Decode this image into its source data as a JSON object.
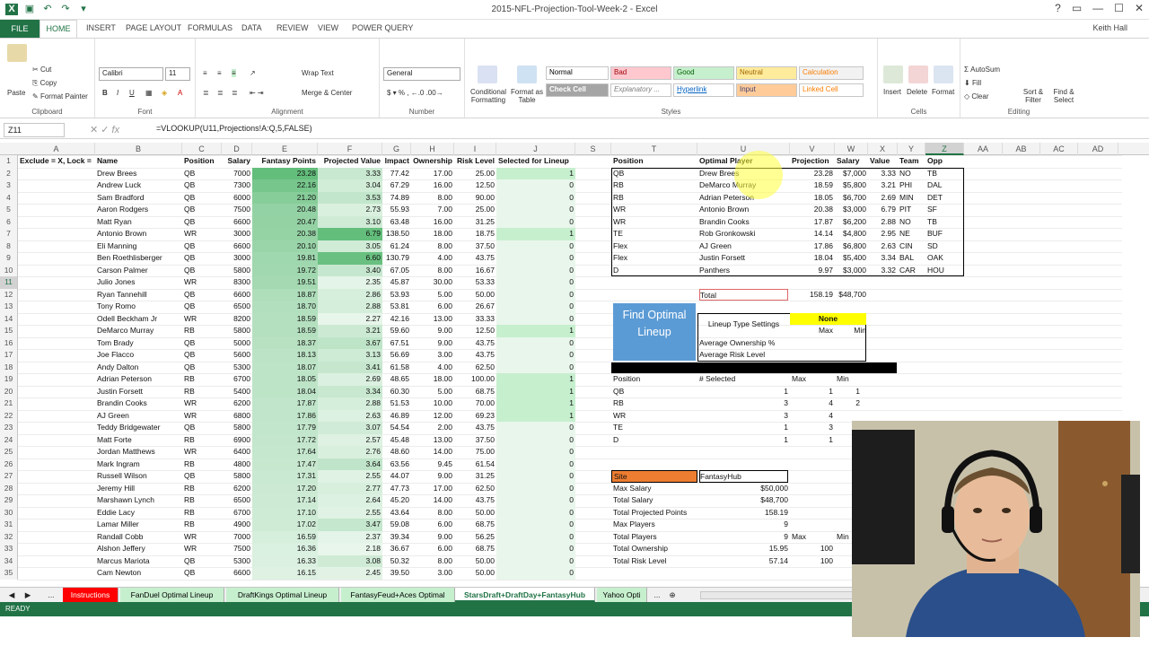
{
  "window": {
    "title": "2015-NFL-Projection-Tool-Week-2 - Excel",
    "user": "Keith Hall",
    "help": "?"
  },
  "menu": [
    "FILE",
    "HOME",
    "INSERT",
    "PAGE LAYOUT",
    "FORMULAS",
    "DATA",
    "REVIEW",
    "VIEW",
    "POWER QUERY"
  ],
  "ribbon": {
    "clipboard": {
      "label": "Clipboard",
      "paste": "Paste",
      "cut": "Cut",
      "copy": "Copy",
      "painter": "Format Painter"
    },
    "font": {
      "label": "Font",
      "name": "Calibri",
      "size": "11"
    },
    "alignment": {
      "label": "Alignment",
      "wrap": "Wrap Text",
      "merge": "Merge & Center"
    },
    "number": {
      "label": "Number",
      "format": "General"
    },
    "styles": {
      "label": "Styles",
      "cond": "Conditional Formatting",
      "table": "Format as Table",
      "items": [
        {
          "t": "Normal",
          "bg": "#ffffff",
          "fg": "#000000"
        },
        {
          "t": "Bad",
          "bg": "#ffc7ce",
          "fg": "#9c0006"
        },
        {
          "t": "Good",
          "bg": "#c6efce",
          "fg": "#006100"
        },
        {
          "t": "Neutral",
          "bg": "#ffeb9c",
          "fg": "#9c6500"
        },
        {
          "t": "Calculation",
          "bg": "#f2f2f2",
          "fg": "#fa7d00"
        },
        {
          "t": "Check Cell",
          "bg": "#a5a5a5",
          "fg": "#ffffff"
        },
        {
          "t": "Explanatory ...",
          "bg": "#ffffff",
          "fg": "#7f7f7f"
        },
        {
          "t": "Hyperlink",
          "bg": "#ffffff",
          "fg": "#0563c1"
        },
        {
          "t": "Input",
          "bg": "#ffcc99",
          "fg": "#3f3f76"
        },
        {
          "t": "Linked Cell",
          "bg": "#ffffff",
          "fg": "#fa7d00"
        }
      ]
    },
    "cells": {
      "label": "Cells",
      "insert": "Insert",
      "delete": "Delete",
      "format": "Format"
    },
    "editing": {
      "label": "Editing",
      "autosum": "AutoSum",
      "fill": "Fill",
      "clear": "Clear",
      "sort": "Sort & Filter",
      "find": "Find & Select"
    }
  },
  "formula_bar": {
    "cell": "Z11",
    "formula": "=VLOOKUP(U11,Projections!A:Q,5,FALSE)",
    "fx": "fx"
  },
  "columns": [
    "A",
    "B",
    "C",
    "D",
    "E",
    "F",
    "G",
    "H",
    "I",
    "J",
    "S",
    "T",
    "U",
    "V",
    "W",
    "X",
    "Y",
    "Z",
    "AA",
    "AB",
    "AC",
    "AD"
  ],
  "left_headers": [
    "Exclude = X, Lock = L",
    "Name",
    "Position",
    "Salary",
    "Fantasy Points",
    "Projected Value",
    "Impact",
    "Ownership",
    "Risk Level",
    "Selected for Lineup"
  ],
  "players": [
    [
      "Drew Brees",
      "QB",
      "7000",
      "23.28",
      "3.33",
      "77.42",
      "17.00",
      "25.00",
      "1"
    ],
    [
      "Andrew Luck",
      "QB",
      "7300",
      "22.16",
      "3.04",
      "67.29",
      "16.00",
      "12.50",
      "0"
    ],
    [
      "Sam Bradford",
      "QB",
      "6000",
      "21.20",
      "3.53",
      "74.89",
      "8.00",
      "90.00",
      "0"
    ],
    [
      "Aaron Rodgers",
      "QB",
      "7500",
      "20.48",
      "2.73",
      "55.93",
      "7.00",
      "25.00",
      "0"
    ],
    [
      "Matt Ryan",
      "QB",
      "6600",
      "20.47",
      "3.10",
      "63.48",
      "16.00",
      "31.25",
      "0"
    ],
    [
      "Antonio Brown",
      "WR",
      "3000",
      "20.38",
      "6.79",
      "138.50",
      "18.00",
      "18.75",
      "1"
    ],
    [
      "Eli Manning",
      "QB",
      "6600",
      "20.10",
      "3.05",
      "61.24",
      "8.00",
      "37.50",
      "0"
    ],
    [
      "Ben Roethlisberger",
      "QB",
      "3000",
      "19.81",
      "6.60",
      "130.79",
      "4.00",
      "43.75",
      "0"
    ],
    [
      "Carson Palmer",
      "QB",
      "5800",
      "19.72",
      "3.40",
      "67.05",
      "8.00",
      "16.67",
      "0"
    ],
    [
      "Julio Jones",
      "WR",
      "8300",
      "19.51",
      "2.35",
      "45.87",
      "30.00",
      "53.33",
      "0"
    ],
    [
      "Ryan Tannehill",
      "QB",
      "6600",
      "18.87",
      "2.86",
      "53.93",
      "5.00",
      "50.00",
      "0"
    ],
    [
      "Tony Romo",
      "QB",
      "6500",
      "18.70",
      "2.88",
      "53.81",
      "6.00",
      "26.67",
      "0"
    ],
    [
      "Odell Beckham Jr",
      "WR",
      "8200",
      "18.59",
      "2.27",
      "42.16",
      "13.00",
      "33.33",
      "0"
    ],
    [
      "DeMarco Murray",
      "RB",
      "5800",
      "18.59",
      "3.21",
      "59.60",
      "9.00",
      "12.50",
      "1"
    ],
    [
      "Tom Brady",
      "QB",
      "5000",
      "18.37",
      "3.67",
      "67.51",
      "9.00",
      "43.75",
      "0"
    ],
    [
      "Joe Flacco",
      "QB",
      "5600",
      "18.13",
      "3.13",
      "56.69",
      "3.00",
      "43.75",
      "0"
    ],
    [
      "Andy Dalton",
      "QB",
      "5300",
      "18.07",
      "3.41",
      "61.58",
      "4.00",
      "62.50",
      "0"
    ],
    [
      "Adrian Peterson",
      "RB",
      "6700",
      "18.05",
      "2.69",
      "48.65",
      "18.00",
      "100.00",
      "1"
    ],
    [
      "Justin Forsett",
      "RB",
      "5400",
      "18.04",
      "3.34",
      "60.30",
      "5.00",
      "68.75",
      "1"
    ],
    [
      "Brandin Cooks",
      "WR",
      "6200",
      "17.87",
      "2.88",
      "51.53",
      "10.00",
      "70.00",
      "1"
    ],
    [
      "AJ Green",
      "WR",
      "6800",
      "17.86",
      "2.63",
      "46.89",
      "12.00",
      "69.23",
      "1"
    ],
    [
      "Teddy Bridgewater",
      "QB",
      "5800",
      "17.79",
      "3.07",
      "54.54",
      "2.00",
      "43.75",
      "0"
    ],
    [
      "Matt Forte",
      "RB",
      "6900",
      "17.72",
      "2.57",
      "45.48",
      "13.00",
      "37.50",
      "0"
    ],
    [
      "Jordan Matthews",
      "WR",
      "6400",
      "17.64",
      "2.76",
      "48.60",
      "14.00",
      "75.00",
      "0"
    ],
    [
      "Mark Ingram",
      "RB",
      "4800",
      "17.47",
      "3.64",
      "63.56",
      "9.45",
      "61.54",
      "0"
    ],
    [
      "Russell Wilson",
      "QB",
      "5800",
      "17.31",
      "2.55",
      "44.07",
      "9.00",
      "31.25",
      "0"
    ],
    [
      "Jeremy Hill",
      "RB",
      "6200",
      "17.20",
      "2.77",
      "47.73",
      "17.00",
      "62.50",
      "0"
    ],
    [
      "Marshawn Lynch",
      "RB",
      "6500",
      "17.14",
      "2.64",
      "45.20",
      "14.00",
      "43.75",
      "0"
    ],
    [
      "Eddie Lacy",
      "RB",
      "6700",
      "17.10",
      "2.55",
      "43.64",
      "8.00",
      "50.00",
      "0"
    ],
    [
      "Lamar Miller",
      "RB",
      "4900",
      "17.02",
      "3.47",
      "59.08",
      "6.00",
      "68.75",
      "0"
    ],
    [
      "Randall Cobb",
      "WR",
      "7000",
      "16.59",
      "2.37",
      "39.34",
      "9.00",
      "56.25",
      "0"
    ],
    [
      "Alshon Jeffery",
      "WR",
      "7500",
      "16.36",
      "2.18",
      "36.67",
      "6.00",
      "68.75",
      "0"
    ],
    [
      "Marcus Mariota",
      "QB",
      "5300",
      "16.33",
      "3.08",
      "50.32",
      "8.00",
      "50.00",
      "0"
    ],
    [
      "Cam Newton",
      "QB",
      "6600",
      "16.15",
      "2.45",
      "39.50",
      "3.00",
      "50.00",
      "0"
    ]
  ],
  "lineup_headers": [
    "Position",
    "Optimal Player",
    "Projection",
    "Salary",
    "Value",
    "Team",
    "Opp"
  ],
  "lineup": [
    [
      "QB",
      "Drew Brees",
      "23.28",
      "$7,000",
      "3.33",
      "NO",
      "TB"
    ],
    [
      "RB",
      "DeMarco Murray",
      "18.59",
      "$5,800",
      "3.21",
      "PHI",
      "DAL"
    ],
    [
      "RB",
      "Adrian Peterson",
      "18.05",
      "$6,700",
      "2.69",
      "MIN",
      "DET"
    ],
    [
      "WR",
      "Antonio Brown",
      "20.38",
      "$3,000",
      "6.79",
      "PIT",
      "SF"
    ],
    [
      "WR",
      "Brandin Cooks",
      "17.87",
      "$6,200",
      "2.88",
      "NO",
      "TB"
    ],
    [
      "TE",
      "Rob Gronkowski",
      "14.14",
      "$4,800",
      "2.95",
      "NE",
      "BUF"
    ],
    [
      "Flex",
      "AJ Green",
      "17.86",
      "$6,800",
      "2.63",
      "CIN",
      "SD"
    ],
    [
      "Flex",
      "Justin Forsett",
      "18.04",
      "$5,400",
      "3.34",
      "BAL",
      "OAK"
    ],
    [
      "D",
      "Panthers",
      "9.97",
      "$3,000",
      "3.32",
      "CAR",
      "HOU"
    ]
  ],
  "total": {
    "label": "Total",
    "projection": "158.19",
    "salary": "$48,700"
  },
  "find_button": "Find Optimal Lineup",
  "settings": {
    "title": "Lineup Type Settings",
    "value": "None",
    "max": "Max",
    "min": "Min",
    "own": "Average Ownership %",
    "risk": "Average Risk Level"
  },
  "constraints": {
    "headers": [
      "Position",
      "# Selected",
      "Max",
      "Min"
    ],
    "rows": [
      [
        "QB",
        "1",
        "1",
        "1"
      ],
      [
        "RB",
        "3",
        "4",
        "2"
      ],
      [
        "WR",
        "3",
        "4",
        ""
      ],
      [
        "TE",
        "1",
        "3",
        ""
      ],
      [
        "D",
        "1",
        "1",
        ""
      ]
    ]
  },
  "site": {
    "label": "Site",
    "value": "FantasyHub"
  },
  "summary": [
    [
      "Max Salary",
      "$50,000",
      "",
      ""
    ],
    [
      "Total Salary",
      "$48,700",
      "",
      ""
    ],
    [
      "Total Projected Points",
      "158.19",
      "",
      ""
    ],
    [
      "Max Players",
      "9",
      "",
      ""
    ],
    [
      "Total Players",
      "9",
      "Max",
      "Min"
    ],
    [
      "Total Ownership",
      "15.95",
      "100",
      ""
    ],
    [
      "Total Risk Level",
      "57.14",
      "100",
      ""
    ]
  ],
  "sheet_tabs": [
    {
      "t": "Instructions",
      "bg": "#ff0000",
      "fg": "#ffffff"
    },
    {
      "t": "FanDuel Optimal Lineup",
      "bg": "#c6efce",
      "fg": "#000000"
    },
    {
      "t": "DraftKings Optimal Lineup",
      "bg": "#c6efce",
      "fg": "#000000"
    },
    {
      "t": "FantasyFeud+Aces Optimal",
      "bg": "#c6efce",
      "fg": "#000000"
    },
    {
      "t": "StarsDraft+DraftDay+FantasyHub",
      "bg": "#ffffff",
      "fg": "#217346"
    },
    {
      "t": "Yahoo Opti",
      "bg": "#c6efce",
      "fg": "#000000"
    }
  ],
  "tab_more": "...",
  "status": "READY",
  "colors": {
    "excel_green": "#217346",
    "heat_dark": "#63be7b",
    "heat_light": "#e9f6ec",
    "select": "#c6efce",
    "blue_btn": "#5b9bd5",
    "orange": "#ed7d31",
    "yellow": "#ffff00"
  }
}
